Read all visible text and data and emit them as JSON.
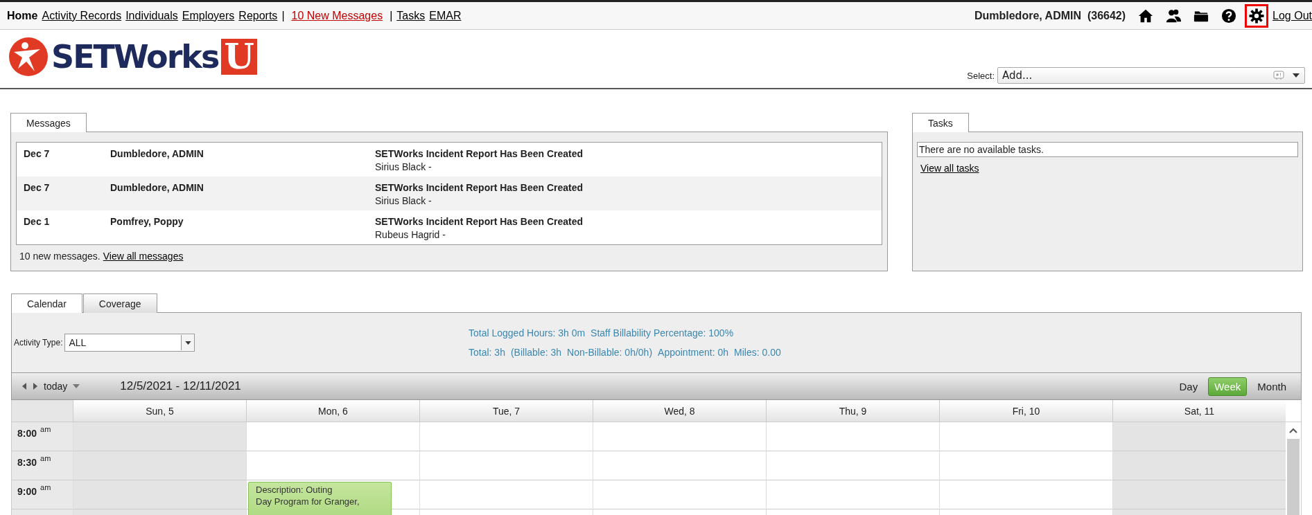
{
  "nav": {
    "links": [
      {
        "kind": "link",
        "label": "Home",
        "selected": true
      },
      {
        "kind": "link",
        "label": "Activity Records",
        "selected": false
      },
      {
        "kind": "link",
        "label": "Individuals",
        "selected": false
      },
      {
        "kind": "link",
        "label": "Employers",
        "selected": false
      },
      {
        "kind": "link",
        "label": "Reports",
        "selected": false
      },
      {
        "kind": "separator",
        "label": "|"
      },
      {
        "kind": "alert",
        "label": "10 New Messages",
        "selected": false
      },
      {
        "kind": "separator",
        "label": "|"
      },
      {
        "kind": "link",
        "label": "Tasks",
        "selected": false
      },
      {
        "kind": "link",
        "label": "EMAR",
        "selected": false
      }
    ],
    "user": "Dumbledore, ADMIN  (36642)",
    "icons": [
      {
        "kind": "home",
        "highlighted": false
      },
      {
        "kind": "people",
        "highlighted": false
      },
      {
        "kind": "folder",
        "highlighted": false
      },
      {
        "kind": "help",
        "highlighted": false
      },
      {
        "kind": "settings",
        "highlighted": true
      }
    ],
    "logout": "Log Out"
  },
  "header": {
    "logo": {
      "text": "SETWorks",
      "suffix": "U"
    },
    "select_label": "Select:",
    "select": {
      "placeholder": "Add..."
    }
  },
  "messages": {
    "tabs": [
      {
        "label": "Messages",
        "selected": true
      }
    ],
    "rows": [
      {
        "date": "Dec 7",
        "from": "Dumbledore, ADMIN",
        "subject": "SETWorks Incident Report Has Been Created",
        "detail": "Sirius Black -"
      },
      {
        "date": "Dec 7",
        "from": "Dumbledore, ADMIN",
        "subject": "SETWorks Incident Report Has Been Created",
        "detail": "Sirius Black -"
      },
      {
        "date": "Dec 1",
        "from": "Pomfrey, Poppy",
        "subject": "SETWorks Incident Report Has Been Created",
        "detail": "Rubeus Hagrid -"
      }
    ],
    "footer": "10 new messages.",
    "footer_link": "View all messages"
  },
  "tasks": {
    "tabs": [
      {
        "label": "Tasks",
        "selected": true
      }
    ],
    "empty": "There are no available tasks.",
    "link": "View all tasks"
  },
  "calendar": {
    "tabs": [
      {
        "label": "Calendar",
        "selected": true
      },
      {
        "label": "Coverage",
        "selected": false
      }
    ],
    "activity_type_label": "Activity Type:",
    "activity_type": "ALL",
    "summary_1": [
      "Total Logged Hours: 3h 0m",
      "Staff Billability Percentage: 100%"
    ],
    "summary_2": [
      "Total: 3h",
      "(Billable: 3h",
      "Non-Billable: 0h/0h)",
      "Appointment: 0h",
      "Miles: 0.00"
    ],
    "today": "today",
    "range": "12/5/2021 - 12/11/2021",
    "views": [
      {
        "label": "Day",
        "selected": false
      },
      {
        "label": "Week",
        "selected": true
      },
      {
        "label": "Month",
        "selected": false
      }
    ],
    "days": [
      {
        "label": "Sun, 5",
        "shaded": true
      },
      {
        "label": "Mon, 6",
        "shaded": false,
        "events": [
          {
            "lines": [
              "Description: Outing",
              "Day Program for Granger,"
            ]
          }
        ]
      },
      {
        "label": "Tue, 7",
        "shaded": false
      },
      {
        "label": "Wed, 8",
        "shaded": false
      },
      {
        "label": "Thu, 9",
        "shaded": false
      },
      {
        "label": "Fri, 10",
        "shaded": false
      },
      {
        "label": "Sat, 11",
        "shaded": true
      }
    ],
    "times": [
      {
        "time": "8:00",
        "suffix": "am"
      },
      {
        "time": "8:30",
        "suffix": "am"
      },
      {
        "time": "9:00",
        "suffix": "am"
      }
    ]
  }
}
